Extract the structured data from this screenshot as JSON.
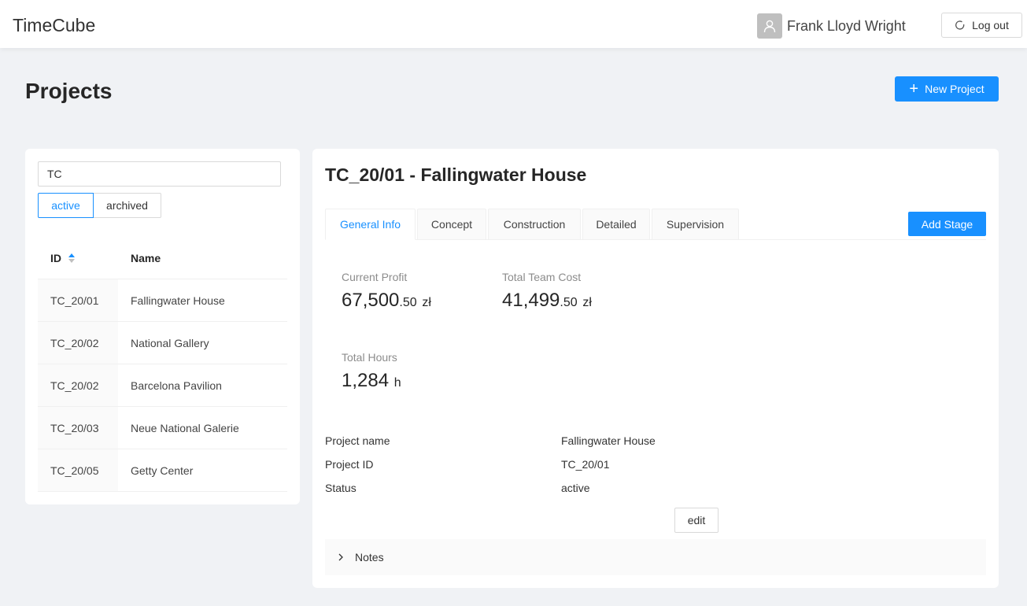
{
  "header": {
    "brand": "TimeCube",
    "user_name": "Frank Lloyd Wright",
    "logout_label": "Log out"
  },
  "page": {
    "title": "Projects",
    "new_project_label": "New Project"
  },
  "project_list": {
    "search_value": "TC",
    "filters": {
      "active_label": "active",
      "archived_label": "archived",
      "selected": "active"
    },
    "columns": {
      "id": "ID",
      "name": "Name"
    },
    "rows": [
      {
        "id": "TC_20/01",
        "name": "Fallingwater House"
      },
      {
        "id": "TC_20/02",
        "name": "National Gallery"
      },
      {
        "id": "TC_20/02",
        "name": "Barcelona Pavilion"
      },
      {
        "id": "TC_20/03",
        "name": "Neue National Galerie"
      },
      {
        "id": "TC_20/05",
        "name": "Getty Center"
      }
    ]
  },
  "detail": {
    "title": "TC_20/01 - Fallingwater House",
    "tabs": [
      {
        "label": "General Info"
      },
      {
        "label": "Concept"
      },
      {
        "label": "Construction"
      },
      {
        "label": "Detailed"
      },
      {
        "label": "Supervision"
      }
    ],
    "active_tab": "General Info",
    "add_stage_label": "Add Stage",
    "stats": {
      "profit": {
        "label": "Current Profit",
        "int": "67,500",
        "dec": ".50",
        "suffix": "zł"
      },
      "team_cost": {
        "label": "Total Team Cost",
        "int": "41,499",
        "dec": ".50",
        "suffix": "zł"
      },
      "hours": {
        "label": "Total Hours",
        "int": "1,284",
        "suffix": "h"
      }
    },
    "info": {
      "name_label": "Project name",
      "name_value": "Fallingwater House",
      "id_label": "Project ID",
      "id_value": "TC_20/01",
      "status_label": "Status",
      "status_value": "active"
    },
    "edit_label": "edit",
    "notes_label": "Notes"
  },
  "colors": {
    "primary": "#1890ff",
    "background": "#f0f2f5"
  }
}
